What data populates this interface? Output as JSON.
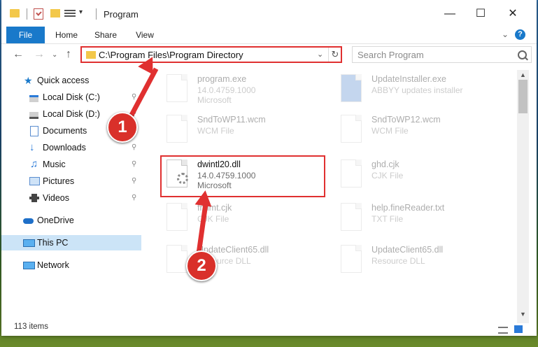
{
  "window": {
    "title": "Program"
  },
  "ribbon": {
    "tabs": [
      "File",
      "Home",
      "Share",
      "View"
    ]
  },
  "address": {
    "path": "C:\\Program Files\\Program Directory"
  },
  "search": {
    "placeholder": "Search Program"
  },
  "sidebar": {
    "items": [
      {
        "label": "Quick access",
        "icon": "star-icon"
      },
      {
        "label": "Local Disk (C:)",
        "icon": "drive-icon",
        "pinned": true
      },
      {
        "label": "Local Disk (D:)",
        "icon": "drive-icon",
        "pinned": true
      },
      {
        "label": "Documents",
        "icon": "documents-icon",
        "pinned": true
      },
      {
        "label": "Downloads",
        "icon": "download-arrow-icon",
        "pinned": true
      },
      {
        "label": "Music",
        "icon": "music-note-icon",
        "pinned": true
      },
      {
        "label": "Pictures",
        "icon": "pictures-icon",
        "pinned": true
      },
      {
        "label": "Videos",
        "icon": "film-icon",
        "pinned": true
      },
      {
        "label": "OneDrive",
        "icon": "cloud-icon"
      },
      {
        "label": "This PC",
        "icon": "monitor-icon",
        "selected": true
      },
      {
        "label": "Network",
        "icon": "network-icon"
      }
    ]
  },
  "files": [
    {
      "name": "program.exe",
      "line2": "14.0.4759.1000",
      "line3": "Microsoft"
    },
    {
      "name": "UpdateInstaller.exe",
      "line2": "ABBYY updates installer",
      "line3": ""
    },
    {
      "name": "SndToWP11.wcm",
      "line2": "WCM File",
      "line3": ""
    },
    {
      "name": "SndToWP12.wcm",
      "line2": "WCM File",
      "line3": ""
    },
    {
      "name": "dwintl20.dll",
      "line2": "14.0.4759.1000",
      "line3": "Microsoft"
    },
    {
      "name": "ghd.cjk",
      "line2": "CJK File",
      "line3": ""
    },
    {
      "name": "fntlmt.cjk",
      "line2": "CJK File",
      "line3": ""
    },
    {
      "name": "help.fineReader.txt",
      "line2": "TXT File",
      "line3": ""
    },
    {
      "name": "UpdateClient65.dll",
      "line2": "Resource DLL",
      "line3": ""
    },
    {
      "name": "UpdateClient65.dll",
      "line2": "Resource DLL",
      "line3": ""
    }
  ],
  "status": {
    "item_count": "113 items"
  },
  "annotations": {
    "step1": "1",
    "step2": "2"
  }
}
